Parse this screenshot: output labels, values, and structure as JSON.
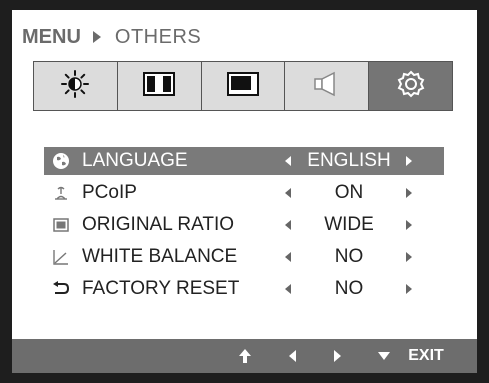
{
  "header": {
    "menu_label": "MENU",
    "section_label": "OTHERS"
  },
  "tabs": [
    {
      "name": "picture-brightness",
      "icon": "brightness-icon",
      "active": false
    },
    {
      "name": "picture-mode",
      "icon": "picture-mode-icon",
      "active": false
    },
    {
      "name": "screen-position",
      "icon": "screen-position-icon",
      "active": false
    },
    {
      "name": "sound",
      "icon": "speaker-icon",
      "active": false
    },
    {
      "name": "others",
      "icon": "gear-icon",
      "active": true
    }
  ],
  "menu": {
    "items": [
      {
        "label": "LANGUAGE",
        "value": "ENGLISH",
        "icon": "globe-icon",
        "selected": true
      },
      {
        "label": "PCoIP",
        "value": "ON",
        "icon": "pcoip-icon",
        "selected": false
      },
      {
        "label": "ORIGINAL RATIO",
        "value": "WIDE",
        "icon": "ratio-icon",
        "selected": false
      },
      {
        "label": "WHITE BALANCE",
        "value": "NO",
        "icon": "white-balance-icon",
        "selected": false
      },
      {
        "label": "FACTORY RESET",
        "value": "NO",
        "icon": "reset-icon",
        "selected": false
      }
    ]
  },
  "bottom_bar": {
    "exit_label": "EXIT"
  },
  "colors": {
    "frame": "#1e1e1e",
    "selected_row": "#7a7a7a",
    "active_tab": "#757575",
    "inactive_tab": "#dcdcdc",
    "bottom_bar": "#6d6d6d"
  }
}
